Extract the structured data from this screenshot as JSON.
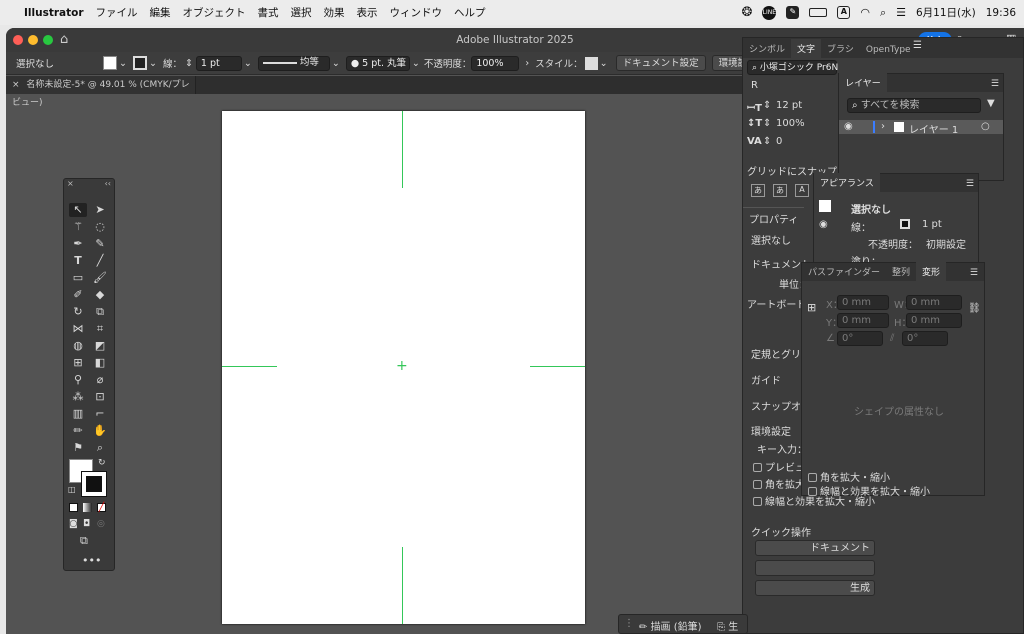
{
  "menubar": {
    "app": "Illustrator",
    "items": [
      "ファイル",
      "編集",
      "オブジェクト",
      "書式",
      "選択",
      "効果",
      "表示",
      "ウィンドウ",
      "ヘルプ"
    ],
    "date": "6月11日(水)",
    "time": "19:36",
    "text_input": "A"
  },
  "window": {
    "title": "Adobe Illustrator 2025",
    "doc_tab": "名称未設定-5* @ 49.01 % (CMYK/プレビュー)",
    "share": "共有"
  },
  "control": {
    "selection": "選択なし",
    "stroke_label": "線：",
    "stroke_value": "1 pt",
    "profile": "均等",
    "brush": "5 pt. 丸筆",
    "opacity_label": "不透明度：",
    "opacity_value": "100%",
    "style_label": "スタイル：",
    "doc_setup": "ドキュメント設定",
    "prefs": "環境設定"
  },
  "char_panel": {
    "tabs": [
      "シンボル",
      "文字",
      "ブラシ",
      "OpenType"
    ],
    "font": "小塚ゴシック Pr6N",
    "style": "R",
    "size": "12 pt",
    "scale": "100%",
    "tracking": "0",
    "glyph_snap": "グリッドにスナップ"
  },
  "props_panel": {
    "tab": "プロパティ",
    "selection": "選択なし",
    "document": "ドキュメント",
    "unit": "単位：",
    "artboard": "アートボード：",
    "rulers": "定規とグリッド",
    "guides": "ガイド",
    "snap": "スナップオプション",
    "prefs": "環境設定",
    "key_input": "キー入力：",
    "preview": "プレビュー",
    "scale_corners": "角を拡大・縮小",
    "scale_strokes": "線幅と効果を拡大・縮小",
    "quick": "クイック操作",
    "btn1": "ドキュメント",
    "btn3": "生成"
  },
  "layers": {
    "title": "レイヤー",
    "search": "すべてを検索",
    "layer1": "レイヤー 1"
  },
  "appearance": {
    "title": "アピアランス",
    "selection": "選択なし",
    "stroke_label": "線：",
    "stroke_value": "1 pt",
    "opacity_label": "不透明度：",
    "opacity_value": "初期設定",
    "fill_label": "塗り："
  },
  "transform": {
    "tabs": [
      "パスファインダー",
      "整列",
      "変形"
    ],
    "x": "X：",
    "y": "Y：",
    "w": "W：",
    "h": "H：",
    "zero": "0 mm",
    "deg": "0°",
    "empty": "シェイプの属性なし",
    "scale_corners": "角を拡大・縮小",
    "scale_strokes": "線幅と効果を拡大・縮小"
  },
  "status": {
    "draw": "描画 (鉛筆)",
    "gen": "生"
  }
}
